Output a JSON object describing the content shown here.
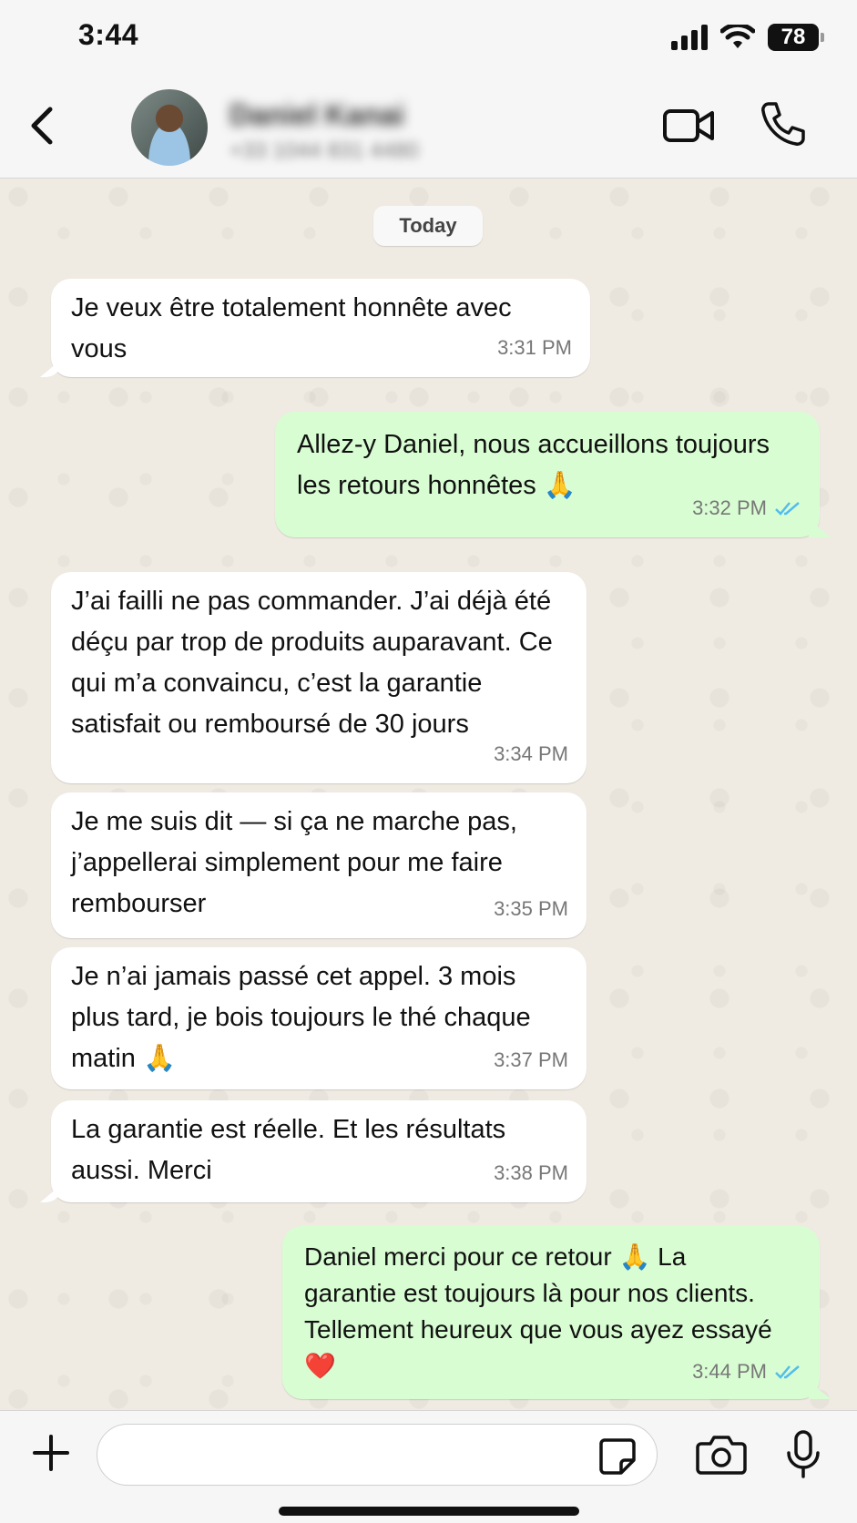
{
  "status_bar": {
    "time": "3:44",
    "battery": "78"
  },
  "header": {
    "contact_name": "Daniel Kanai",
    "contact_phone": "+33 1044 831 4480"
  },
  "chat": {
    "date_chip": "Today",
    "messages": [
      {
        "direction": "in",
        "text": "Je veux être totalement honnête avec vous",
        "time": "3:31 PM"
      },
      {
        "direction": "out",
        "text": "Allez-y Daniel, nous accueillons toujours les retours honnêtes 🙏",
        "time": "3:32 PM",
        "status": "read"
      },
      {
        "direction": "in",
        "text": "J’ai failli ne pas commander. J’ai déjà été déçu par trop de produits auparavant. Ce qui m’a convaincu, c’est la garantie satisfait ou remboursé de 30 jours",
        "time": "3:34 PM"
      },
      {
        "direction": "in",
        "text": "Je me suis dit — si ça ne marche pas, j’appellerai simplement pour me faire rembourser",
        "time": "3:35 PM"
      },
      {
        "direction": "in",
        "text": "Je n’ai jamais passé cet appel. 3 mois plus tard, je bois toujours le thé chaque matin 🙏",
        "time": "3:37 PM"
      },
      {
        "direction": "in",
        "text": "La garantie est réelle. Et les résultats aussi. Merci",
        "time": "3:38 PM"
      },
      {
        "direction": "out",
        "text": "Daniel merci pour ce retour 🙏 La garantie est toujours là pour nos clients. Tellement heureux que vous ayez essayé ❤️",
        "time": "3:44 PM",
        "status": "read"
      }
    ]
  },
  "input_bar": {
    "placeholder": "",
    "value": ""
  },
  "icons": {
    "back": "chevron-left-icon",
    "video": "video-camera-icon",
    "call": "phone-icon",
    "add": "plus-icon",
    "sticker": "sticker-icon",
    "camera": "camera-icon",
    "mic": "microphone-icon",
    "read": "double-check-icon"
  },
  "colors": {
    "chat_bg": "#efeae2",
    "incoming_bubble": "#ffffff",
    "outgoing_bubble": "#d9fdd3",
    "read_ticks": "#53bdeb"
  }
}
